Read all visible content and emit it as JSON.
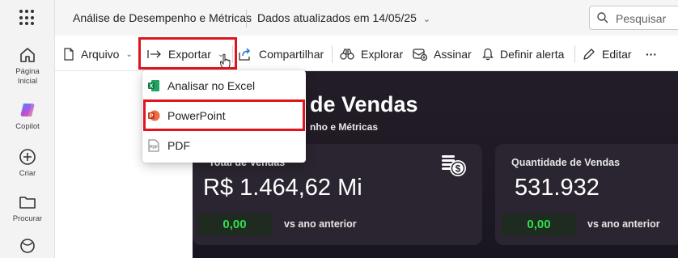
{
  "rail": {
    "items": [
      {
        "label_line1": "Página",
        "label_line2": "Inicial",
        "icon": "home-icon"
      },
      {
        "label_line1": "Copilot",
        "icon": "copilot-icon"
      },
      {
        "label_line1": "Criar",
        "icon": "create-icon"
      },
      {
        "label_line1": "Procurar",
        "icon": "browse-icon"
      },
      {
        "label_line1": "",
        "icon": "hub-icon"
      }
    ]
  },
  "header": {
    "title": "Análise de Desempenho e Métricas",
    "updated": "Dados atualizados em 14/05/25",
    "search_placeholder": "Pesquisar"
  },
  "toolbar": {
    "file_label": "Arquivo",
    "export_label": "Exportar",
    "share_label": "Compartilhar",
    "explore_label": "Explorar",
    "subscribe_label": "Assinar",
    "alert_label": "Definir alerta",
    "edit_label": "Editar",
    "more_label": "···"
  },
  "export_menu": {
    "items": [
      {
        "label": "Analisar no Excel",
        "icon": "excel-icon"
      },
      {
        "label": "PowerPoint",
        "icon": "powerpoint-icon"
      },
      {
        "label": "PDF",
        "icon": "pdf-icon"
      }
    ]
  },
  "report": {
    "title": "de Vendas",
    "subtitle": "nho e Métricas",
    "cards": [
      {
        "label": "Total de Vendas",
        "value": "R$ 1.464,62 Mi",
        "delta": "0,00",
        "compare": "vs ano anterior"
      },
      {
        "label": "Quantidade de Vendas",
        "value": "531.932",
        "delta": "0,00",
        "compare": "vs ano anterior"
      }
    ]
  },
  "colors": {
    "highlight": "#e0141e",
    "delta_green": "#2fe04a",
    "report_bg": "#1e1a22"
  }
}
